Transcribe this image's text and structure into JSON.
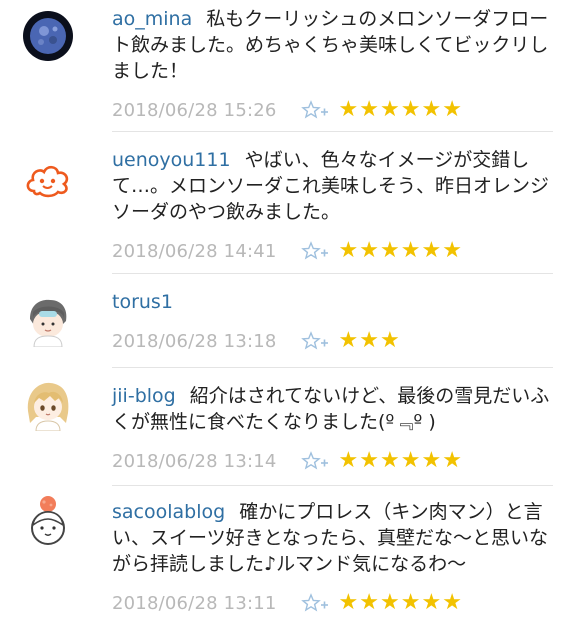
{
  "comments": [
    {
      "username": "ao_mina",
      "text": "私もクーリッシュのメロンソーダフロート飲みました。めちゃくちゃ美味しくてビックリしました！",
      "timestamp": "2018/06/28 15:26",
      "stars": 6,
      "avatar_icon": "moon-avatar-icon"
    },
    {
      "username": "uenoyou111",
      "text": "やばい、色々なイメージが交錯して…。メロンソーダこれ美味しそう、昨日オレンジソーダのやつ飲みました。",
      "timestamp": "2018/06/28 14:41",
      "stars": 6,
      "avatar_icon": "blob-face-avatar-icon"
    },
    {
      "username": "torus1",
      "text": "",
      "timestamp": "2018/06/28 13:18",
      "stars": 3,
      "avatar_icon": "boy-avatar-icon"
    },
    {
      "username": "jii-blog",
      "text": "紹介はされてないけど、最後の雪見だいふくが無性に食べたくなりました(º﹃º )",
      "timestamp": "2018/06/28 13:14",
      "stars": 6,
      "avatar_icon": "blonde-girl-avatar-icon"
    },
    {
      "username": "sacoolablog",
      "text": "確かにプロレス（キン肉マン）と言い、スイーツ好きとなったら、真壁だな〜と思いながら拝読しました♪ルマンド気になるわ〜",
      "timestamp": "2018/06/28 13:11",
      "stars": 6,
      "avatar_icon": "bun-girl-avatar-icon"
    }
  ],
  "colors": {
    "username": "#2f6fa3",
    "star": "#f2c200",
    "timestamp": "#b8b8b8",
    "star_add": "#9fc0de"
  }
}
